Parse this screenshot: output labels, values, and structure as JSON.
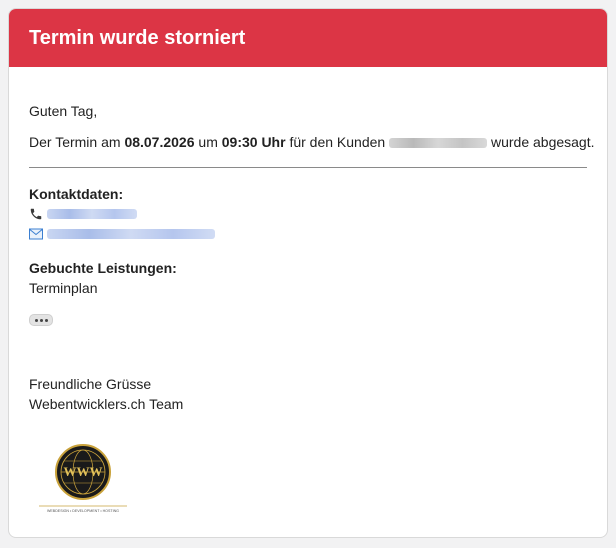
{
  "email": {
    "title": "Termin wurde storniert",
    "greeting": "Guten Tag,",
    "message": {
      "prefix": "Der Termin am ",
      "date": "08.07.2026",
      "middle": " um ",
      "time": "09:30 Uhr",
      "suffix": " für den Kunden ",
      "after_name": " wurde abgesagt."
    },
    "contact": {
      "title": "Kontaktdaten:",
      "phone_icon": "phone-icon",
      "email_icon": "email-icon"
    },
    "services": {
      "title": "Gebuchte Leistungen:",
      "item": "Terminplan"
    },
    "closing": {
      "line1": "Freundliche Grüsse",
      "line2": "Webentwicklers.ch Team"
    },
    "logo": {
      "icon": "globe-logo-icon",
      "text": "WEBDESIGN • DEVELOPMENT • HOSTING",
      "monogram": "WWW"
    }
  },
  "colors": {
    "header": "#dc3545",
    "background": "#f2f2f3",
    "link": "#3b6fd8"
  }
}
